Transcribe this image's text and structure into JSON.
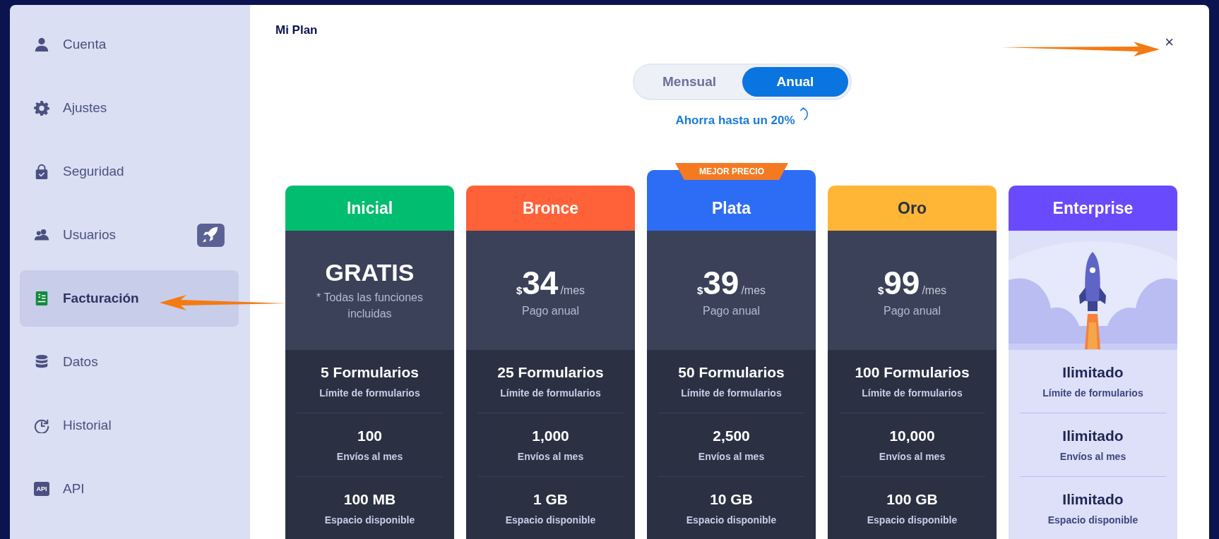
{
  "sidebar": {
    "items": [
      {
        "label": "Cuenta",
        "selected": false
      },
      {
        "label": "Ajustes",
        "selected": false
      },
      {
        "label": "Seguridad",
        "selected": false
      },
      {
        "label": "Usuarios",
        "selected": false,
        "upgrade": true
      },
      {
        "label": "Facturación",
        "selected": true
      },
      {
        "label": "Datos",
        "selected": false
      },
      {
        "label": "Historial",
        "selected": false
      },
      {
        "label": "API",
        "selected": false,
        "icon_text": "API"
      }
    ]
  },
  "title": "Mi Plan",
  "close": "×",
  "billing_toggle": {
    "options": [
      {
        "label": "Mensual",
        "selected": false
      },
      {
        "label": "Anual",
        "selected": true
      }
    ],
    "savings": "Ahorra hasta un 20%"
  },
  "plans": [
    {
      "name": "Inicial",
      "color": "#01bd6f",
      "kind": "free",
      "price": "GRATIS",
      "note": "* Todas las funciones incluidas",
      "features": [
        {
          "value": "5 Formularios",
          "label": "Límite de formularios"
        },
        {
          "value": "100",
          "label": "Envíos al mes"
        },
        {
          "value": "100 MB",
          "label": "Espacio disponible"
        }
      ]
    },
    {
      "name": "Bronce",
      "color": "#ff6139",
      "kind": "paid",
      "currency": "$",
      "price": "34",
      "period": "/mes",
      "note": "Pago anual",
      "features": [
        {
          "value": "25 Formularios",
          "label": "Límite de formularios"
        },
        {
          "value": "1,000",
          "label": "Envíos al mes"
        },
        {
          "value": "1 GB",
          "label": "Espacio disponible"
        }
      ]
    },
    {
      "name": "Plata",
      "color": "#2d6df6",
      "kind": "paid",
      "badge": "MEJOR PRECIO",
      "currency": "$",
      "price": "39",
      "period": "/mes",
      "note": "Pago anual",
      "features": [
        {
          "value": "50 Formularios",
          "label": "Límite de formularios"
        },
        {
          "value": "2,500",
          "label": "Envíos al mes"
        },
        {
          "value": "10 GB",
          "label": "Espacio disponible"
        }
      ]
    },
    {
      "name": "Oro",
      "color": "#ffb636",
      "kind": "paid",
      "currency": "$",
      "price": "99",
      "period": "/mes",
      "note": "Pago anual",
      "features": [
        {
          "value": "100 Formularios",
          "label": "Límite de formularios"
        },
        {
          "value": "10,000",
          "label": "Envíos al mes"
        },
        {
          "value": "100 GB",
          "label": "Espacio disponible"
        }
      ]
    },
    {
      "name": "Enterprise",
      "color": "#6a4afd",
      "kind": "enterprise",
      "features": [
        {
          "value": "Ilimitado",
          "label": "Límite de formularios"
        },
        {
          "value": "Ilimitado",
          "label": "Envíos al mes"
        },
        {
          "value": "Ilimitado",
          "label": "Espacio disponible"
        }
      ]
    }
  ]
}
